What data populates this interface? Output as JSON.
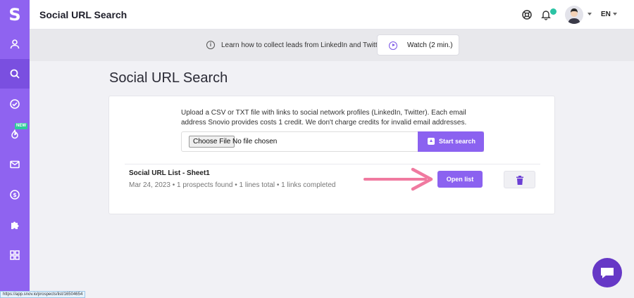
{
  "sidebar": {
    "logo": "S",
    "items": [
      {
        "name": "prospects",
        "icon": "person-icon"
      },
      {
        "name": "search",
        "icon": "search-icon",
        "active": true
      },
      {
        "name": "verify",
        "icon": "check-circle-icon"
      },
      {
        "name": "drip",
        "icon": "flame-icon",
        "badge": "NEW"
      },
      {
        "name": "email",
        "icon": "mail-icon"
      },
      {
        "name": "billing",
        "icon": "dollar-icon"
      },
      {
        "name": "integrations",
        "icon": "puzzle-icon"
      },
      {
        "name": "apps",
        "icon": "grid-icon"
      }
    ]
  },
  "header": {
    "title": "Social URL Search",
    "language": "EN",
    "icons": [
      "help-wheel-icon",
      "bell-icon",
      "avatar"
    ]
  },
  "infobar": {
    "text": "Learn how to collect leads from LinkedIn and Twitter",
    "watch_label": "Watch (2 min.)"
  },
  "page": {
    "title": "Social URL Search",
    "description": "Upload a CSV or TXT file with links to social network profiles (LinkedIn, Twitter). Each email address Snovio provides costs 1 credit. We don't charge credits for invalid email addresses.",
    "choose_file_label": "Choose File",
    "no_file_text": "No file chosen",
    "start_search_label": "Start search"
  },
  "list": {
    "title": "Social URL List - Sheet1",
    "meta": "Mar 24, 2023 • 1 prospects found • 1 lines total • 1 links completed",
    "open_label": "Open list"
  },
  "status_url": "https://app.snov.io/prospects/list/16504654",
  "colors": {
    "accent": "#8b62f0",
    "sidebar": "#8f63f0",
    "arrow": "#f07aa0",
    "chat": "#6638c6"
  }
}
